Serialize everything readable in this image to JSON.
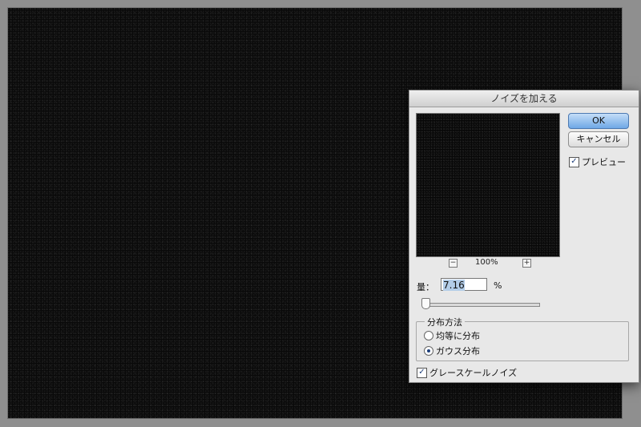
{
  "dialog": {
    "title": "ノイズを加える",
    "ok_label": "OK",
    "cancel_label": "キャンセル",
    "preview_label": "プレビュー",
    "preview_checked": true,
    "zoom_minus": "−",
    "zoom_plus": "+",
    "zoom_level": "100%",
    "amount_label": "量：",
    "amount_value": "7.16",
    "amount_unit": "%",
    "distribution": {
      "title": "分布方法",
      "uniform_label": "均等に分布",
      "gaussian_label": "ガウス分布",
      "selected": "gaussian"
    },
    "monochromatic_label": "グレースケールノイズ",
    "monochromatic_checked": true
  },
  "colors": {
    "canvas": "#0a0a0a",
    "dialog_bg": "#e8e8e8",
    "ok_button": "#6fa7e6",
    "selection": "#b3cde8"
  },
  "icons": {
    "check": "✓"
  }
}
